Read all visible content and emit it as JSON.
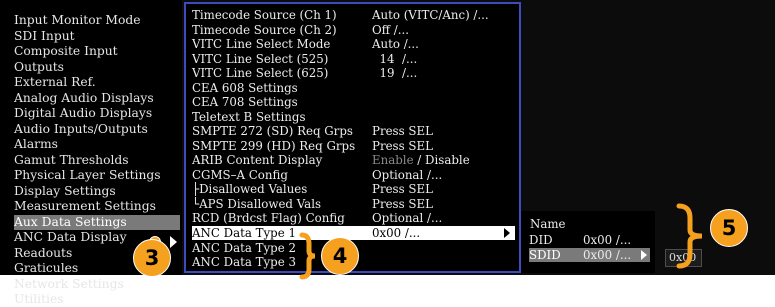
{
  "main_menu": {
    "items": [
      {
        "label": "Input Monitor Mode"
      },
      {
        "label": "SDI Input"
      },
      {
        "label": "Composite Input"
      },
      {
        "label": "Outputs"
      },
      {
        "label": "External Ref."
      },
      {
        "label": "Analog Audio Displays"
      },
      {
        "label": "Digital Audio Displays"
      },
      {
        "label": "Audio Inputs/Outputs"
      },
      {
        "label": "Alarms"
      },
      {
        "label": "Gamut Thresholds"
      },
      {
        "label": "Physical Layer Settings"
      },
      {
        "label": "Display Settings"
      },
      {
        "label": "Measurement Settings"
      },
      {
        "label": "Aux Data Settings"
      },
      {
        "label": "ANC Data Display"
      },
      {
        "label": "Readouts"
      },
      {
        "label": "Graticules"
      },
      {
        "label": "Network Settings"
      },
      {
        "label": "Utilities"
      }
    ],
    "selected": "Aux Data Settings"
  },
  "aux_menu": {
    "rows": [
      {
        "label": "Timecode Source (Ch 1)",
        "value": "Auto (VITC/Anc) /..."
      },
      {
        "label": "Timecode Source (Ch 2)",
        "value": "Off /..."
      },
      {
        "label": "VITC Line Select Mode",
        "value": "Auto /..."
      },
      {
        "label": "VITC Line Select (525)",
        "value": "  14  /..."
      },
      {
        "label": "VITC Line Select (625)",
        "value": "  19  /..."
      },
      {
        "label": "CEA 608 Settings",
        "value": ""
      },
      {
        "label": "CEA 708 Settings",
        "value": ""
      },
      {
        "label": "Teletext B Settings",
        "value": ""
      },
      {
        "label": "SMPTE 272 (SD) Req Grps",
        "value": "Press SEL"
      },
      {
        "label": "SMPTE 299 (HD) Req Grps",
        "value": "Press SEL"
      },
      {
        "label": "ARIB Content Display",
        "value_dim": "Enable",
        "value_sep": " / ",
        "value": "Disable"
      },
      {
        "label": "CGMS–A Config",
        "value": "Optional /..."
      },
      {
        "label": "├Disallowed Values",
        "value": "Press SEL"
      },
      {
        "label": "└APS Disallowed Vals",
        "value": "Press SEL"
      },
      {
        "label": "RCD (Brdcst Flag) Config",
        "value": "Optional /..."
      },
      {
        "label": "ANC Data Type 1",
        "value": "0x00 /..."
      },
      {
        "label": "ANC Data Type 2",
        "value": ""
      },
      {
        "label": "ANC Data Type 3",
        "value": ""
      }
    ],
    "selected": "ANC Data Type 1"
  },
  "anc_submenu": {
    "title": "Name",
    "rows": [
      {
        "label": "DID",
        "value": "0x00 /..."
      },
      {
        "label": "SDID",
        "value": "0x00 /..."
      }
    ],
    "selected": "SDID"
  },
  "edit_field": {
    "value": "0x00"
  },
  "callouts": [
    "3",
    "4",
    "5"
  ],
  "colors": {
    "callout": "#f5a01e",
    "menu_border": "#3c4cc0",
    "selection_gray": "#7a7a7a"
  }
}
